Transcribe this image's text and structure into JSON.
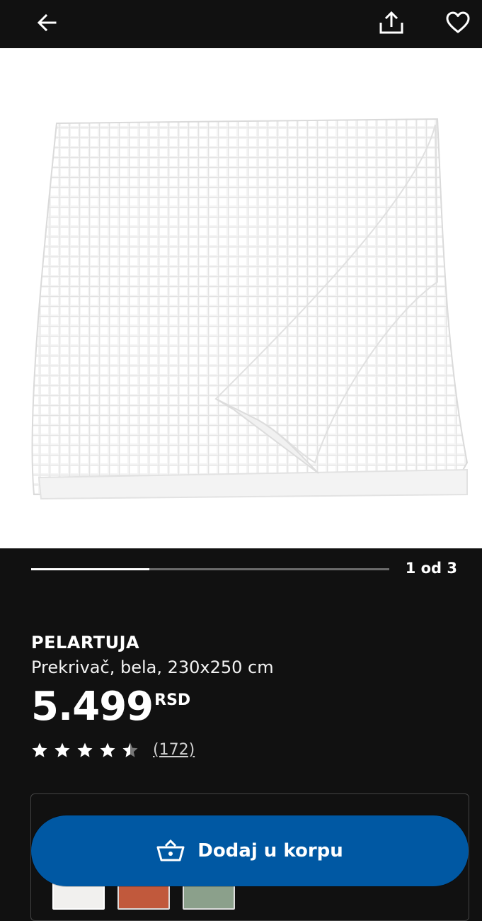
{
  "header": {
    "back_icon": "arrow-left-icon",
    "share_icon": "share-icon",
    "favorite_icon": "heart-icon"
  },
  "gallery": {
    "counter": "1 od 3",
    "progress": 0.33
  },
  "product": {
    "name": "PELARTUJA",
    "description": "Prekrivač, bela, 230x250 cm",
    "price": "5.499",
    "currency": "RSD",
    "rating": 4.5,
    "review_count": "(172)"
  },
  "cart": {
    "label": "Dodaj u korpu",
    "icon": "basket-icon"
  },
  "variants": [
    {
      "name": "white",
      "color": "#f1f0ee"
    },
    {
      "name": "rust",
      "color": "#c1593c"
    },
    {
      "name": "green",
      "color": "#8ba08b"
    }
  ],
  "colors": {
    "background": "#111111",
    "accent_blue": "#0058a3"
  }
}
